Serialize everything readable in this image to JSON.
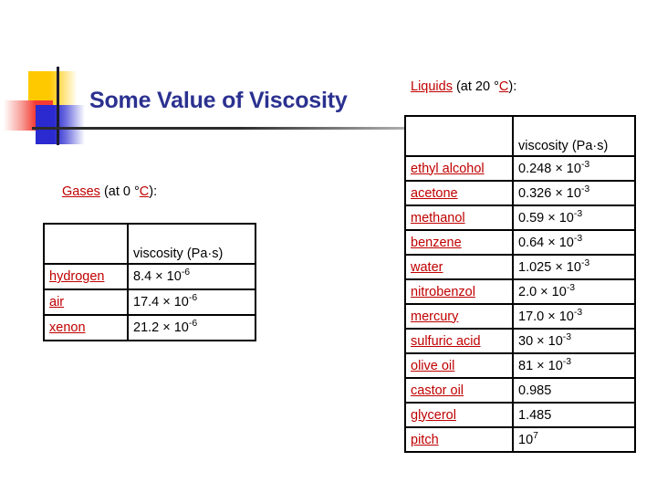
{
  "slide": {
    "title": "Some Value of Viscosity",
    "title_color": "#2b3190",
    "link_color": "#c00000",
    "background": "#ffffff"
  },
  "logo": {
    "yellow": "#ffc900",
    "red": "#f43a32",
    "blue": "#2a2ad0",
    "rule": "#2b2b2b"
  },
  "gases": {
    "caption_link": "Gases",
    "caption_mid": " (at 0 °",
    "caption_unit": "C",
    "caption_end": "):",
    "header_blank": "",
    "header_viscosity": "viscosity (Pa·s)",
    "rows": [
      {
        "name": "hydrogen",
        "mantissa": "8.4 × 10",
        "exponent": "-6"
      },
      {
        "name": "air",
        "mantissa": "17.4 × 10",
        "exponent": "-6"
      },
      {
        "name": "xenon",
        "mantissa": "21.2 × 10",
        "exponent": "-6"
      }
    ]
  },
  "liquids": {
    "caption_link": "Liquids",
    "caption_mid": " (at 20 °",
    "caption_unit": "C",
    "caption_end": "):",
    "header_blank": "",
    "header_viscosity": "viscosity (Pa·s)",
    "rows": [
      {
        "name": "ethyl alcohol",
        "mantissa": "0.248 × 10",
        "exponent": "-3"
      },
      {
        "name": "acetone",
        "mantissa": "0.326 × 10",
        "exponent": "-3"
      },
      {
        "name": "methanol",
        "mantissa": "0.59 × 10",
        "exponent": "-3"
      },
      {
        "name": "benzene",
        "mantissa": "0.64 × 10",
        "exponent": "-3"
      },
      {
        "name": "water",
        "mantissa": "1.025 × 10",
        "exponent": "-3"
      },
      {
        "name": "nitrobenzol",
        "mantissa": "2.0 × 10",
        "exponent": "-3"
      },
      {
        "name": "mercury",
        "mantissa": "17.0 × 10",
        "exponent": "-3"
      },
      {
        "name": "sulfuric acid",
        "mantissa": "30 × 10",
        "exponent": "-3"
      },
      {
        "name": "olive oil",
        "mantissa": "81 × 10",
        "exponent": "-3"
      },
      {
        "name": "castor oil",
        "mantissa": "0.985",
        "exponent": ""
      },
      {
        "name": "glycerol",
        "mantissa": "1.485",
        "exponent": ""
      },
      {
        "name": "pitch",
        "mantissa": "10",
        "exponent": "7"
      }
    ]
  }
}
